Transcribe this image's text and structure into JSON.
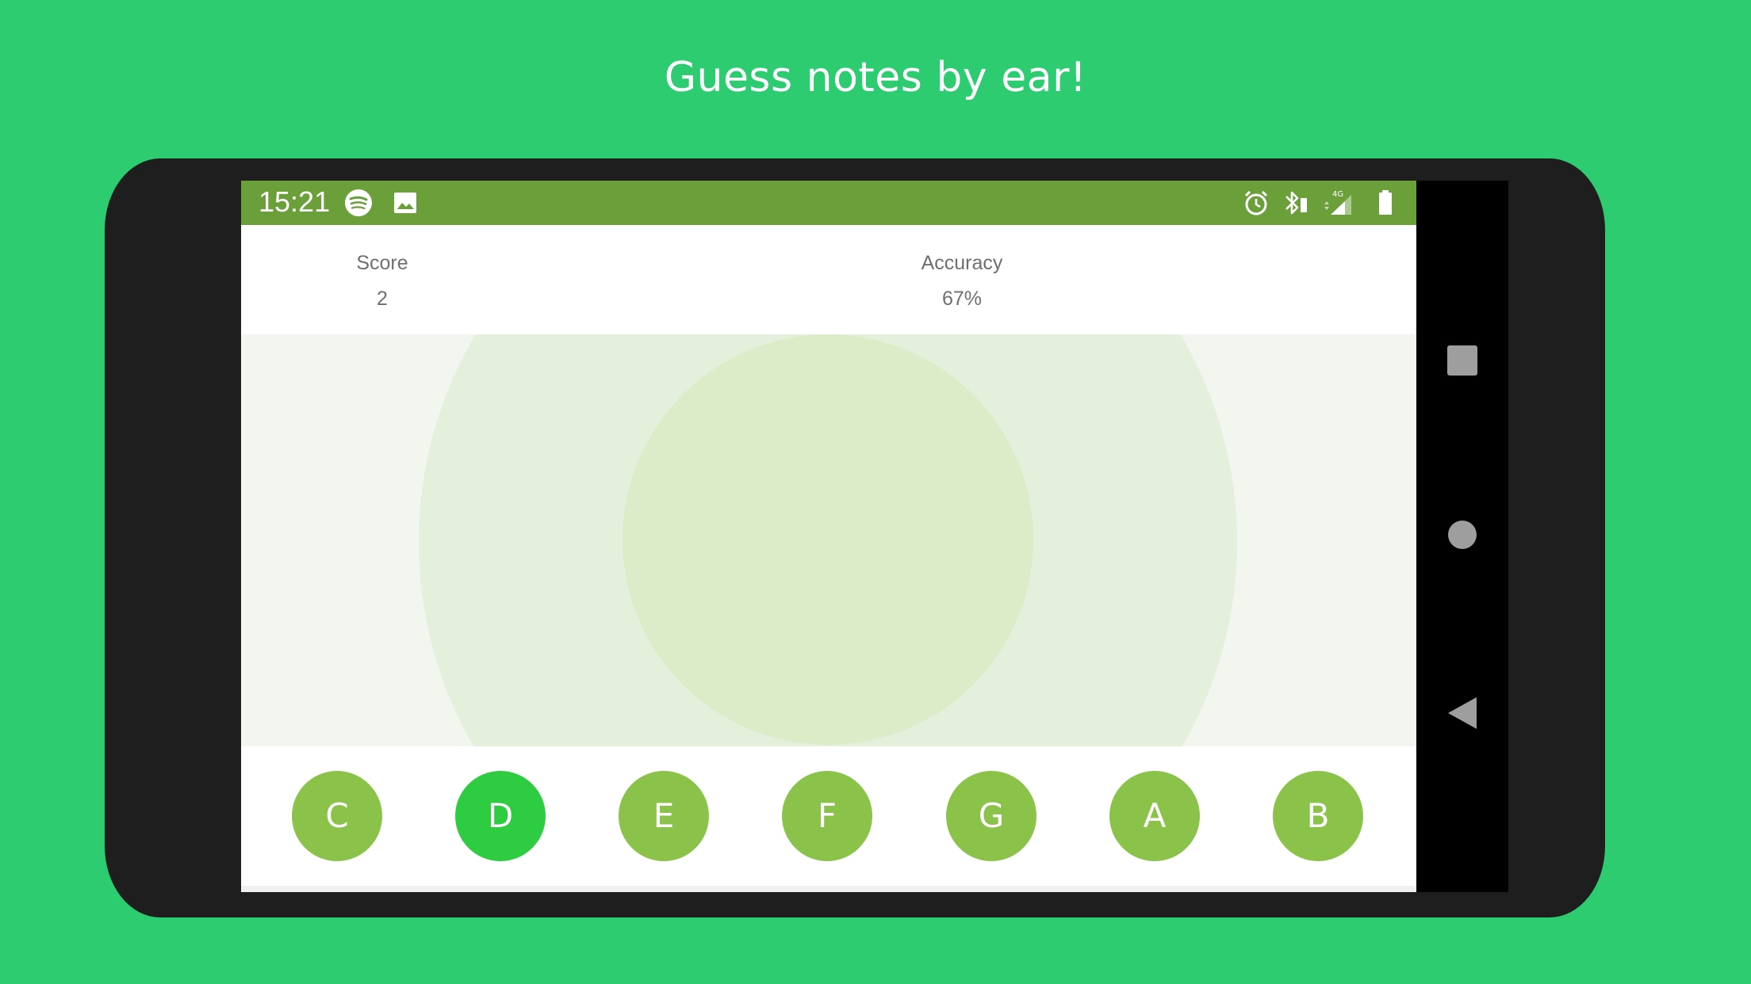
{
  "headline": "Guess notes by ear!",
  "status_bar": {
    "time": "15:21",
    "network": "4G"
  },
  "stats": {
    "score_label": "Score",
    "score_value": "2",
    "accuracy_label": "Accuracy",
    "accuracy_value": "67%"
  },
  "notes": [
    "C",
    "D",
    "E",
    "F",
    "G",
    "A",
    "B"
  ],
  "selected_note": "D",
  "colors": {
    "background": "#2ecc71",
    "status_bar": "#6a9f3a",
    "note_button": "#8bc34a",
    "note_button_active": "#2ecc40"
  },
  "icons": {
    "status_left": [
      "spotify-icon",
      "image-icon"
    ],
    "status_right": [
      "alarm-icon",
      "bluetooth-icon",
      "signal-icon",
      "battery-icon"
    ],
    "nav": [
      "recents-icon",
      "home-icon",
      "back-icon"
    ]
  }
}
